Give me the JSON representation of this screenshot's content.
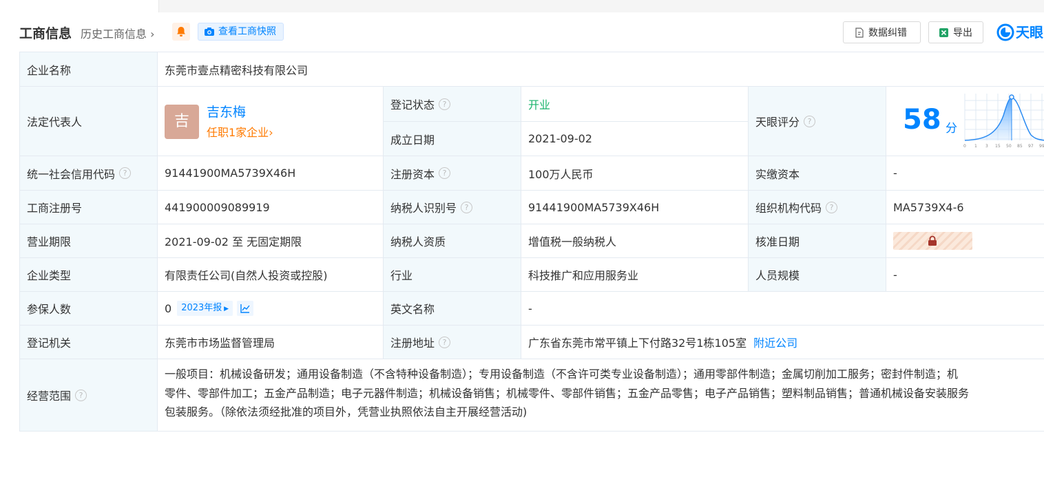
{
  "header": {
    "title": "工商信息",
    "history_link": "历史工商信息",
    "snapshot_button": "查看工商快照",
    "correct_button": "数据纠错",
    "export_button": "导出",
    "logo_text": "天眼"
  },
  "colors": {
    "accent": "#0084ff",
    "status_open": "#1ab36b",
    "orange": "#ff7a00",
    "label_bg": "#f2f9fc"
  },
  "company_name": {
    "label": "企业名称",
    "value": "东莞市壹点精密科技有限公司"
  },
  "legal_rep": {
    "label": "法定代表人",
    "avatar_char": "吉",
    "name": "吉东梅",
    "positions": "任职1家企业"
  },
  "reg_status": {
    "label": "登记状态",
    "value": "开业"
  },
  "found_date": {
    "label": "成立日期",
    "value": "2021-09-02"
  },
  "tianyan_score": {
    "label": "天眼评分",
    "score": "58",
    "unit": "分",
    "chart_ticks": [
      "0",
      "1",
      "3",
      "15",
      "50",
      "85",
      "97",
      "99"
    ]
  },
  "credit_code": {
    "label": "统一社会信用代码",
    "value": "91441900MA5739X46H"
  },
  "reg_capital": {
    "label": "注册资本",
    "value": "100万人民币"
  },
  "paid_capital": {
    "label": "实缴资本",
    "value": "-"
  },
  "biz_reg_no": {
    "label": "工商注册号",
    "value": "441900009089919"
  },
  "taxpayer_id": {
    "label": "纳税人识别号",
    "value": "91441900MA5739X46H"
  },
  "org_code": {
    "label": "组织机构代码",
    "value": "MA5739X4-6"
  },
  "biz_term": {
    "label": "营业期限",
    "value": "2021-09-02 至 无固定期限"
  },
  "taxpayer_qual": {
    "label": "纳税人资质",
    "value": "增值税一般纳税人"
  },
  "approve_date": {
    "label": "核准日期"
  },
  "company_type": {
    "label": "企业类型",
    "value": "有限责任公司(自然人投资或控股)"
  },
  "industry": {
    "label": "行业",
    "value": "科技推广和应用服务业"
  },
  "staff_size": {
    "label": "人员规模",
    "value": "-"
  },
  "insured": {
    "label": "参保人数",
    "value": "0",
    "report_tag": "2023年报"
  },
  "english_name": {
    "label": "英文名称",
    "value": "-"
  },
  "reg_authority": {
    "label": "登记机关",
    "value": "东莞市市场监督管理局"
  },
  "reg_address": {
    "label": "注册地址",
    "value": "广东省东莞市常平镇上下付路32号1栋105室",
    "nearby": "附近公司"
  },
  "biz_scope": {
    "label": "经营范围",
    "lines": [
      "一般项目：机械设备研发；通用设备制造（不含特种设备制造）；专用设备制造（不含许可类专业设备制造）；通用零部件制造；金属切削加工服务；密封件制造；机",
      "零件、零部件加工；五金产品制造；电子元器件制造；机械设备销售；机械零件、零部件销售；五金产品零售；电子产品销售；塑料制品销售；普通机械设备安装服务",
      "包装服务。（除依法须经批准的项目外，凭营业执照依法自主开展经营活动)"
    ]
  }
}
